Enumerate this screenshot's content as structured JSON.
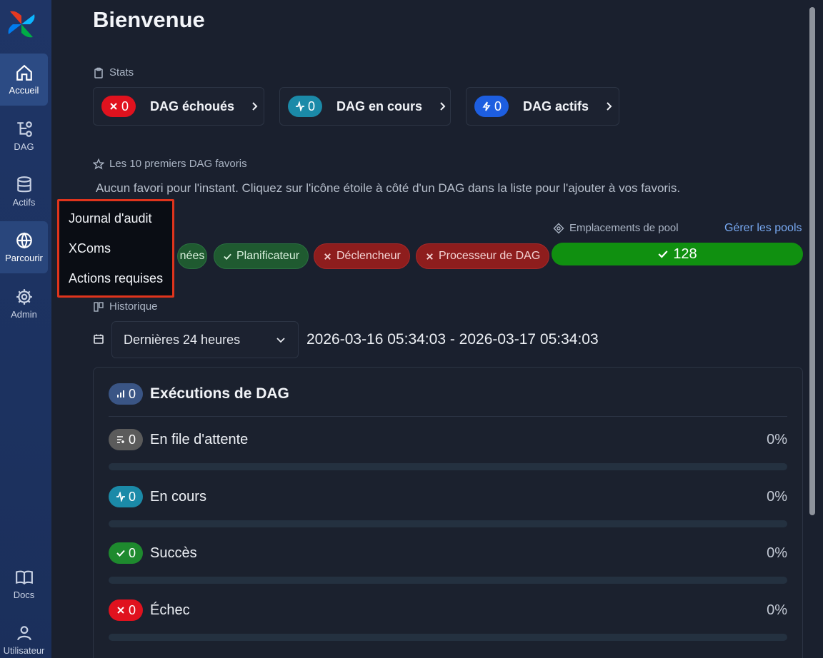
{
  "sidebar": {
    "items": [
      {
        "label": "Accueil",
        "icon": "home-icon"
      },
      {
        "label": "DAG",
        "icon": "dag-icon"
      },
      {
        "label": "Actifs",
        "icon": "database-icon"
      },
      {
        "label": "Parcourir",
        "icon": "globe-icon"
      },
      {
        "label": "Admin",
        "icon": "gear-icon"
      },
      {
        "label": "Docs",
        "icon": "book-icon"
      },
      {
        "label": "Utilisateur",
        "icon": "user-icon"
      }
    ],
    "active": "Accueil"
  },
  "browse_menu": {
    "items": [
      "Journal d'audit",
      "XComs",
      "Actions requises"
    ]
  },
  "page": {
    "title": "Bienvenue"
  },
  "stats": {
    "label": "Stats",
    "cards": [
      {
        "count": "0",
        "label": "DAG échoués",
        "icon": "x-icon",
        "color": "#e0121e"
      },
      {
        "count": "0",
        "label": "DAG en cours",
        "icon": "activity-icon",
        "color": "#1b8aa8"
      },
      {
        "count": "0",
        "label": "DAG actifs",
        "icon": "bolt-icon",
        "color": "#1d5ee0"
      }
    ]
  },
  "favorites": {
    "label": "Les 10 premiers DAG favoris",
    "empty_message": "Aucun favori pour l'instant. Cliquez sur l'icône étoile à côté d'un DAG dans la liste pour l'ajouter à vos favoris."
  },
  "health": {
    "pills": [
      {
        "label": "nées",
        "status": "ok"
      },
      {
        "label": "Planificateur",
        "status": "ok"
      },
      {
        "label": "Déclencheur",
        "status": "error"
      },
      {
        "label": "Processeur de DAG",
        "status": "error"
      }
    ]
  },
  "pools": {
    "label": "Emplacements de pool",
    "manage_link": "Gérer les pools",
    "value": "128"
  },
  "history": {
    "label": "Historique",
    "range_select": "Dernières 24 heures",
    "range_text": "2026-03-16 05:34:03 - 2026-03-17 05:34:03",
    "panel": {
      "title": "Exécutions de DAG",
      "count": "0",
      "rows": [
        {
          "label": "En file d'attente",
          "count": "0",
          "pct": "0%",
          "fraction": 0,
          "icon": "queue-icon",
          "color": "#5b5b5b"
        },
        {
          "label": "En cours",
          "count": "0",
          "pct": "0%",
          "fraction": 0,
          "icon": "activity-icon",
          "color": "#1b8aa8"
        },
        {
          "label": "Succès",
          "count": "0",
          "pct": "0%",
          "fraction": 0,
          "icon": "check-icon",
          "color": "#1e8a2e"
        },
        {
          "label": "Échec",
          "count": "0",
          "pct": "0%",
          "fraction": 0,
          "icon": "x-icon",
          "color": "#e0121e"
        }
      ]
    }
  }
}
